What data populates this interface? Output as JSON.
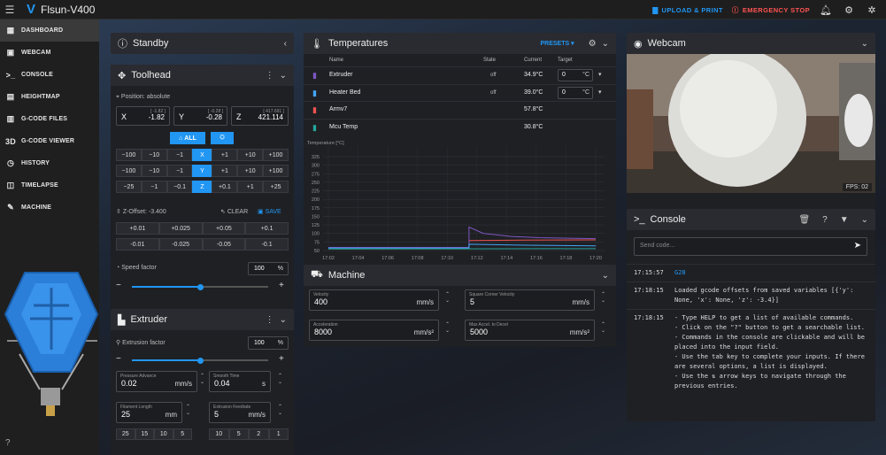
{
  "app": {
    "logo": "V",
    "title": "Flsun-V400",
    "upload_print": "UPLOAD & PRINT",
    "emergency_stop": "EMERGENCY STOP"
  },
  "nav": [
    {
      "label": "DASHBOARD",
      "icon": "▦"
    },
    {
      "label": "WEBCAM",
      "icon": "▣"
    },
    {
      "label": "CONSOLE",
      "icon": ">_"
    },
    {
      "label": "HEIGHTMAP",
      "icon": "▤"
    },
    {
      "label": "G-CODE FILES",
      "icon": "▥"
    },
    {
      "label": "G-CODE VIEWER",
      "icon": "3D"
    },
    {
      "label": "HISTORY",
      "icon": "◷"
    },
    {
      "label": "TIMELAPSE",
      "icon": "◫"
    },
    {
      "label": "MACHINE",
      "icon": "✎"
    }
  ],
  "standby": {
    "title": "Standby"
  },
  "toolhead": {
    "title": "Toolhead",
    "position_label": "Position: absolute",
    "x": {
      "label": "X",
      "hint": "[ -1.82 ]",
      "value": "-1.82"
    },
    "y": {
      "label": "Y",
      "hint": "[ -0.28 ]",
      "value": "-0.28"
    },
    "z": {
      "label": "Z",
      "hint": "[ 417.691 ]",
      "value": "421.114"
    },
    "home_all": "ALL",
    "rows": [
      [
        "−100",
        "−10",
        "−1",
        "X",
        "+1",
        "+10",
        "+100"
      ],
      [
        "−100",
        "−10",
        "−1",
        "Y",
        "+1",
        "+10",
        "+100"
      ],
      [
        "−25",
        "−1",
        "−0.1",
        "Z",
        "+0.1",
        "+1",
        "+25"
      ]
    ],
    "zoffset_label": "Z-Offset: -3.400",
    "clear": "CLEAR",
    "save": "SAVE",
    "zup": [
      "+0.01",
      "+0.025",
      "+0.05",
      "+0.1"
    ],
    "zdown": [
      "-0.01",
      "-0.025",
      "-0.05",
      "-0.1"
    ],
    "speed_label": "Speed factor",
    "speed_value": "100",
    "speed_unit": "%",
    "speed_level": 0.5
  },
  "extruder": {
    "title": "Extruder",
    "factor_label": "Extrusion factor",
    "factor_value": "100",
    "factor_unit": "%",
    "factor_level": 0.5,
    "pa_label": "Pressure Advance",
    "pa_value": "0.02",
    "pa_unit": "mm/s",
    "st_label": "Smooth Time",
    "st_value": "0.04",
    "st_unit": "s",
    "fl_label": "Filament Length",
    "fl_value": "25",
    "fl_unit": "mm",
    "fr_label": "Extrusion Feedrate",
    "fr_value": "5",
    "fr_unit": "mm/s",
    "len_btns": [
      "25",
      "15",
      "10",
      "5"
    ],
    "rate_btns": [
      "10",
      "5",
      "2",
      "1"
    ]
  },
  "temps": {
    "title": "Temperatures",
    "presets": "PRESETS",
    "headers": {
      "name": "Name",
      "state": "State",
      "current": "Current",
      "target": "Target"
    },
    "rows": [
      {
        "name": "Extruder",
        "state": "off",
        "current": "34.9°C",
        "target": "0",
        "unit": "°C",
        "color": "#7e57c2"
      },
      {
        "name": "Heater Bed",
        "state": "off",
        "current": "39.0°C",
        "target": "0",
        "unit": "°C",
        "color": "#42a5f5"
      },
      {
        "name": "Armv7",
        "state": "",
        "current": "57.8°C",
        "target": "",
        "unit": "",
        "color": "#ef5350"
      },
      {
        "name": "Mcu Temp",
        "state": "",
        "current": "30.8°C",
        "target": "",
        "unit": "",
        "color": "#26a69a"
      }
    ]
  },
  "chart_data": {
    "type": "line",
    "ylabel": "Temperature [°C]",
    "yticks": [
      "325",
      "300",
      "275",
      "250",
      "225",
      "200",
      "175",
      "150",
      "125",
      "100",
      "75",
      "50"
    ],
    "xticks": [
      "17:02",
      "17:04",
      "17:06",
      "17:08",
      "17:10",
      "17:12",
      "17:14",
      "17:16",
      "17:18",
      "17:20"
    ],
    "ylim": [
      25,
      325
    ],
    "series": [
      {
        "color": "#7e57c2",
        "points": [
          [
            17.02,
            35
          ],
          [
            17.12,
            35
          ],
          [
            17.12,
            100
          ],
          [
            17.13,
            80
          ],
          [
            17.15,
            70
          ],
          [
            17.17,
            66
          ],
          [
            17.21,
            63
          ]
        ]
      },
      {
        "color": "#ef5350",
        "points": [
          [
            17.12,
            57
          ],
          [
            17.16,
            58
          ],
          [
            17.21,
            59
          ]
        ]
      },
      {
        "color": "#42a5f5",
        "points": [
          [
            17.02,
            33
          ],
          [
            17.12,
            33
          ],
          [
            17.12,
            45
          ],
          [
            17.16,
            42
          ],
          [
            17.21,
            40
          ]
        ]
      },
      {
        "color": "#26a69a",
        "points": [
          [
            17.02,
            30
          ],
          [
            17.21,
            31
          ]
        ]
      }
    ]
  },
  "machine": {
    "title": "Machine",
    "velocity_label": "Velocity",
    "velocity_value": "400",
    "velocity_unit": "mm/s",
    "scv_label": "Square Corner Velocity",
    "scv_value": "5",
    "scv_unit": "mm/s",
    "accel_label": "Acceleration",
    "accel_value": "8000",
    "accel_unit": "mm/s²",
    "decel_label": "Max Accel. to Decel",
    "decel_value": "5000",
    "decel_unit": "mm/s²"
  },
  "webcam": {
    "title": "Webcam",
    "fps": "FPS: 02"
  },
  "console": {
    "title": "Console",
    "placeholder": "Send code...",
    "entries": [
      {
        "time": "17:15:57",
        "lines": [
          "G28"
        ]
      },
      {
        "time": "17:18:15",
        "lines": [
          "Loaded gcode offsets from saved variables [{'y':",
          "None, 'x': None, 'z': -3.4}]"
        ]
      },
      {
        "time": "17:18:15",
        "lines": [
          "- Type HELP to get a list of available commands.",
          "- Click on the \"?\" button to get a searchable list.",
          "- Commands in the console are clickable and will be",
          "placed into the input field.",
          "- Use the tab key to complete your inputs. If there",
          "are several options, a list is displayed.",
          "- Use the ⇅ arrow keys to navigate through the",
          "previous entries."
        ]
      }
    ]
  }
}
